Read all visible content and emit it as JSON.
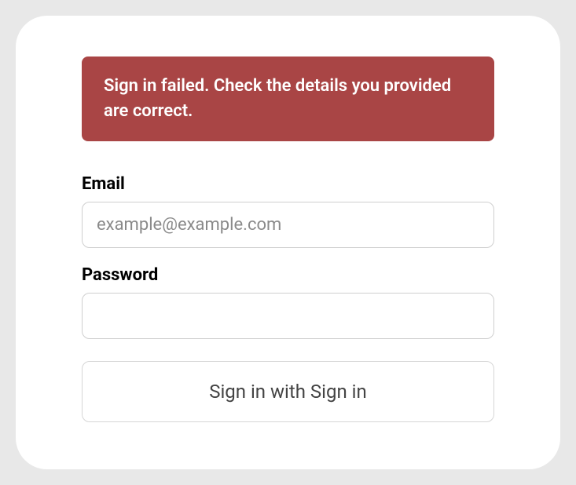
{
  "alert": {
    "message": "Sign in failed. Check the details you provided are correct."
  },
  "form": {
    "email": {
      "label": "Email",
      "placeholder": "example@example.com",
      "value": ""
    },
    "password": {
      "label": "Password",
      "value": ""
    },
    "submit": {
      "label": "Sign in with Sign in"
    }
  }
}
